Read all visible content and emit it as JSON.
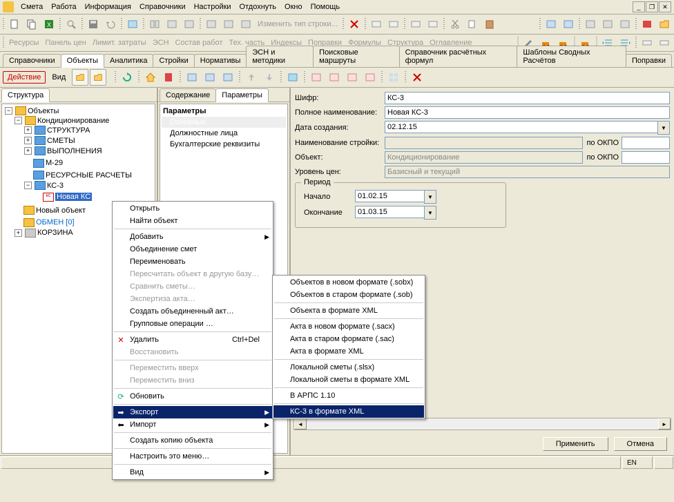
{
  "menu": {
    "items": [
      "Смета",
      "Работа",
      "Информация",
      "Справочники",
      "Настройки",
      "Отдохнуть",
      "Окно",
      "Помощь"
    ]
  },
  "secondary": {
    "items": [
      "Ресурсы",
      "Панель цен",
      "Лимит. затраты",
      "ЭСН",
      "Состав работ",
      "Тех. часть",
      "Индексы",
      "Поправки",
      "Формулы",
      "Структура",
      "Оглавление"
    ]
  },
  "tabs": {
    "items": [
      "Справочники",
      "Объекты",
      "Аналитика",
      "Стройки",
      "Нормативы",
      "ЭСН и методики",
      "Поисковые маршруты",
      "Справочник расчётных формул",
      "Шаблоны Сводных Расчётов",
      "Поправки"
    ],
    "active": 1
  },
  "actionbar": {
    "action": "Действие",
    "view": "Вид"
  },
  "changeRowType": "Изменить тип строки...",
  "leftPanel": {
    "title": "Структура"
  },
  "tree": {
    "root": "Объекты",
    "n0": "Кондиционирование",
    "n0_0": "СТРУКТУРА",
    "n0_1": "СМЕТЫ",
    "n0_2": "ВЫПОЛНЕНИЯ",
    "n0_3": "М-29",
    "n0_4": "РЕСУРСНЫЕ РАСЧЕТЫ",
    "n0_5": "КС-3",
    "n0_5_0": "Новая КС",
    "n1": "Новый объект",
    "n2": "ОБМЕН  [0]",
    "n3": "КОРЗИНА"
  },
  "midTabs": {
    "t0": "Содержание",
    "t1": "Параметры"
  },
  "midPanel": {
    "header": "Параметры",
    "i0": "Основные",
    "i1": "Должностные лица",
    "i2": "Бухгалтерские реквизиты"
  },
  "form": {
    "l_code": "Шифр:",
    "v_code": "КС-3",
    "l_name": "Полное наименование:",
    "v_name": "Новая КС-3",
    "l_date": "Дата создания:",
    "v_date": "02.12.15",
    "l_build": "Наименование стройки:",
    "v_build": "",
    "l_obj": "Объект:",
    "v_obj": "Кондиционирование",
    "l_level": "Уровень цен:",
    "v_level": "Базисный и текущий",
    "okpo": "по ОКПО",
    "period": "Период",
    "l_start": "Начало",
    "v_start": "01.02.15",
    "l_end": "Окончание",
    "v_end": "01.03.15"
  },
  "buttons": {
    "apply": "Применить",
    "cancel": "Отмена"
  },
  "status": {
    "lang": "EN"
  },
  "ctx1": {
    "open": "Открыть",
    "find": "Найти объект",
    "add": "Добавить",
    "merge": "Объединение смет",
    "rename": "Переименовать",
    "recalc": "Пересчитать объект в другую базу…",
    "compare": "Сравнить сметы…",
    "expert": "Экспертиза акта…",
    "combo": "Создать объединенный акт…",
    "group": "Групповые операции …",
    "del": "Удалить",
    "del_sc": "Ctrl+Del",
    "restore": "Восстановить",
    "up": "Переместить вверх",
    "down": "Переместить вниз",
    "refresh": "Обновить",
    "export": "Экспорт",
    "import": "Импорт",
    "copy": "Создать копию объекта",
    "configure": "Настроить это меню…",
    "view": "Вид"
  },
  "ctx2": {
    "i0": "Объектов в новом формате (.sobx)",
    "i1": "Объектов в старом формате (.sob)",
    "i2": "Объекта в формате XML",
    "i3": "Акта в новом формате (.sacx)",
    "i4": "Акта в старом формате (.sac)",
    "i5": "Акта в формате XML",
    "i6": "Локальной сметы (.slsx)",
    "i7": "Локальной сметы в формате XML",
    "i8": "В АРПС 1.10",
    "i9": "КС-3 в формате XML"
  }
}
